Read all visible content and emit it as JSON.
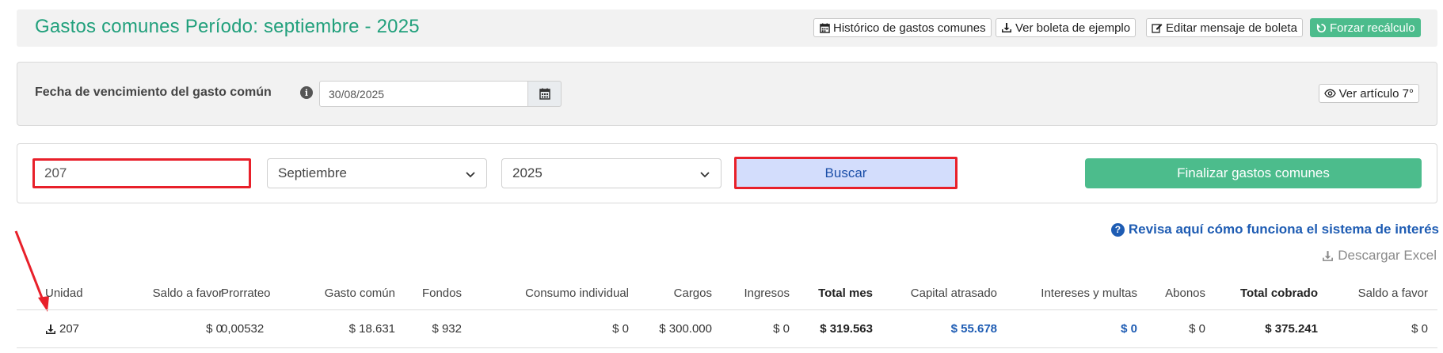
{
  "header": {
    "title": "Gastos comunes Período: septiembre - 2025",
    "buttons": {
      "historico": "Histórico de gastos comunes",
      "ver_boleta": "Ver boleta de ejemplo",
      "editar_mensaje": "Editar mensaje de boleta",
      "forzar": "Forzar recálculo"
    }
  },
  "due": {
    "label": "Fecha de vencimiento del gasto común",
    "date_value": "30/08/2025",
    "ver_articulo": "Ver artículo 7°"
  },
  "filter": {
    "unit_value": "207",
    "month_selected": "Septiembre",
    "year_selected": "2025",
    "buscar": "Buscar",
    "finalizar": "Finalizar gastos comunes"
  },
  "links": {
    "interest": "Revisa aquí cómo funciona el sistema de interés",
    "excel": "Descargar Excel"
  },
  "table": {
    "headers": {
      "unidad": "Unidad",
      "saldo_favor": "Saldo a favor",
      "prorrateo": "Prorrateo",
      "gasto_comun": "Gasto común",
      "fondos": "Fondos",
      "consumo": "Consumo individual",
      "cargos": "Cargos",
      "ingresos": "Ingresos",
      "total_mes": "Total mes",
      "capital": "Capital atrasado",
      "intereses": "Intereses y multas",
      "abonos": "Abonos",
      "total_cobrado": "Total cobrado",
      "saldo_favor2": "Saldo a favor"
    },
    "rows": [
      {
        "unidad": "207",
        "saldo_favor": "$ 0",
        "prorrateo": "0,00532",
        "gasto_comun": "$ 18.631",
        "fondos": "$ 932",
        "consumo": "$ 0",
        "cargos": "$ 300.000",
        "ingresos": "$ 0",
        "total_mes": "$ 319.563",
        "capital": "$ 55.678",
        "intereses": "$ 0",
        "abonos": "$ 0",
        "total_cobrado": "$ 375.241",
        "saldo_favor2": "$ 0"
      }
    ]
  },
  "colors": {
    "brand_green": "#21a07c",
    "button_green": "#4cbc8c",
    "link_blue": "#1e5cb3",
    "highlight_red": "#e8202a",
    "buscar_bg": "#d3ddfc"
  }
}
